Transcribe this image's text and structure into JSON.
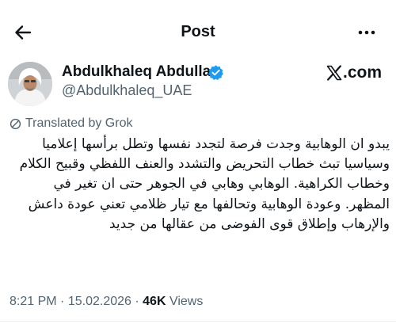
{
  "header": {
    "title": "Post",
    "back_icon": "back-arrow-icon",
    "more_icon": "more-dots-icon"
  },
  "author": {
    "name": "Abdulkhaleq Abdulla",
    "handle": "@Abdulkhaleq_UAE",
    "verified_icon": "verified-badge-icon",
    "verified_color": "#1d9bf0"
  },
  "source": {
    "label": ".com"
  },
  "translation": {
    "label": "Translated by Grok",
    "icon": "translate-icon"
  },
  "post": {
    "text": "يبدو ان الوهابية وجدت فرصة لتجدد نفسها وتطل برأسها إعلاميا وسياسيا تبث خطاب التحريض والتشدد والعنف اللفظي وقبيح الكلام وخطاب الكراهية. الوهابي وهابي في الجوهر حتى ان تغير في المظهر. وعودة الوهابية وتحالفها مع تيار ظلامي تعني عودة داعش والإرهاب وإطلاق قوى الفوضى من عقالها من جديد"
  },
  "meta": {
    "time": "8:21 PM",
    "date": "15.02.2026",
    "views_count": "46K",
    "views_label": "Views",
    "separator": "·"
  }
}
